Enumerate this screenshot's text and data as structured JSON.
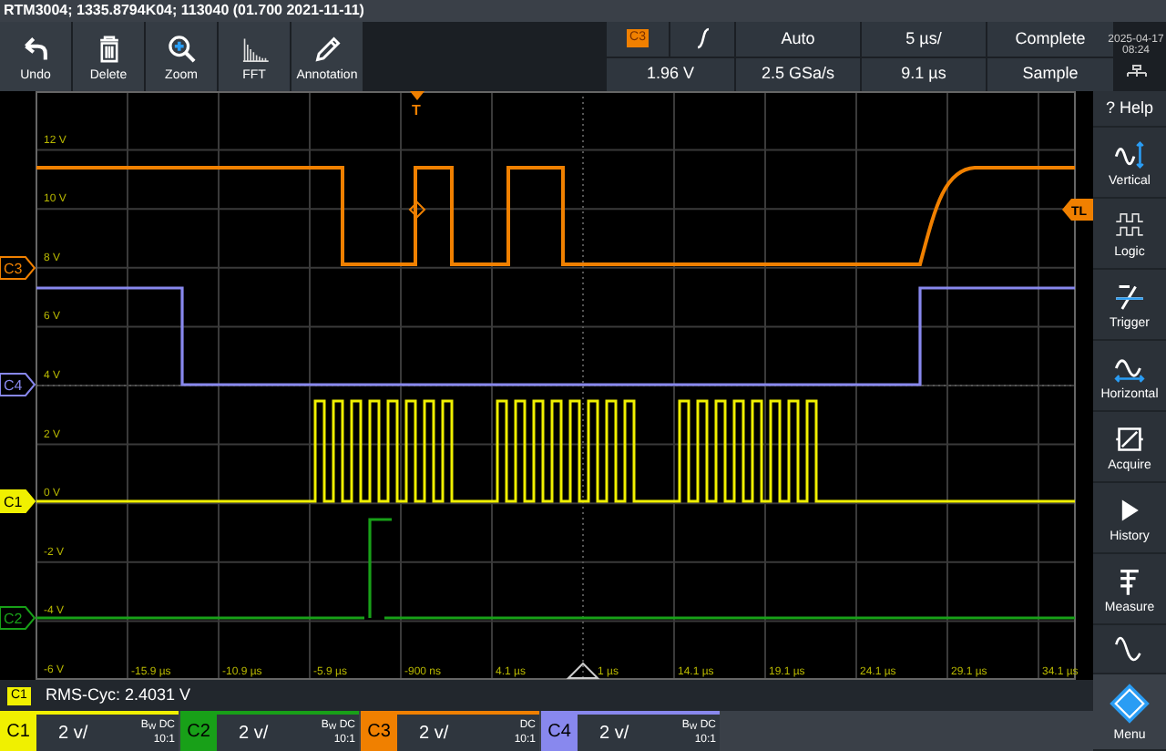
{
  "title_bar": {
    "text": "RTM3004; 1335.8794K04; 113040 (01.700 2021-11-11)"
  },
  "toolbar": [
    {
      "kind": "undo",
      "label": "Undo"
    },
    {
      "kind": "delete",
      "label": "Delete"
    },
    {
      "kind": "zoom",
      "label": "Zoom"
    },
    {
      "kind": "fft",
      "label": "FFT"
    },
    {
      "kind": "annotation",
      "label": "Annotation"
    }
  ],
  "trigger_panel": {
    "source": {
      "label": "C3",
      "color": "#f08000"
    },
    "mode": "Auto",
    "timebase": "5 µs/",
    "status": "Complete",
    "trigger_level_reading": "1.96 V",
    "sample_rate": "2.5 GSa/s",
    "position": "9.1 µs",
    "acquisition": "Sample"
  },
  "datetime": {
    "date": "2025-04-17",
    "time": "08:24"
  },
  "grid": {
    "y_labels": [
      "12 V",
      "10 V",
      "8 V",
      "6 V",
      "4 V",
      "2 V",
      "0 V",
      "-2 V",
      "-4 V",
      "-6 V"
    ],
    "x_labels": [
      "-15.9 µs",
      "-10.9 µs",
      "-5.9 µs",
      "-900 ns",
      "4.1 µs",
      "1 µs",
      "14.1 µs",
      "19.1 µs",
      "24.1 µs",
      "29.1 µs",
      "34.1 µs"
    ]
  },
  "trigger_marker": {
    "label": "T"
  },
  "trigger_level_marker": {
    "label": "TL"
  },
  "channel_markers": [
    {
      "label": "C3",
      "color": "#f08000",
      "filled": false
    },
    {
      "label": "C4",
      "color": "#8888ee",
      "filled": false
    },
    {
      "label": "C1",
      "color": "#f0f000",
      "filled": true
    },
    {
      "label": "C2",
      "color": "#18a018",
      "filled": false
    }
  ],
  "sidebar": [
    {
      "kind": "help",
      "label": "? Help"
    },
    {
      "kind": "vertical",
      "label": "Vertical"
    },
    {
      "kind": "logic",
      "label": "Logic"
    },
    {
      "kind": "trigger",
      "label": "Trigger"
    },
    {
      "kind": "horizontal",
      "label": "Horizontal"
    },
    {
      "kind": "acquire",
      "label": "Acquire"
    },
    {
      "kind": "history",
      "label": "History"
    },
    {
      "kind": "measure",
      "label": "Measure"
    },
    {
      "kind": "math"
    },
    {
      "kind": "menu",
      "label": "Menu"
    }
  ],
  "measurement": {
    "channel": "C1",
    "text": "RMS-Cyc: 2.4031 V"
  },
  "channels": [
    {
      "label": "C1",
      "color": "#f0f000",
      "scale": "2 v/",
      "coupling": "B$_{W}$ DC",
      "probe": "10:1"
    },
    {
      "label": "C2",
      "color": "#18a018",
      "scale": "2 v/",
      "coupling": "B$_{W}$ DC",
      "probe": "10:1"
    },
    {
      "label": "C3",
      "color": "#f08000",
      "scale": "2 v/",
      "coupling": "DC",
      "probe": "10:1"
    },
    {
      "label": "C4",
      "color": "#8888ee",
      "scale": "2 v/",
      "coupling": "B$_{W}$ DC",
      "probe": "10:1"
    }
  ]
}
